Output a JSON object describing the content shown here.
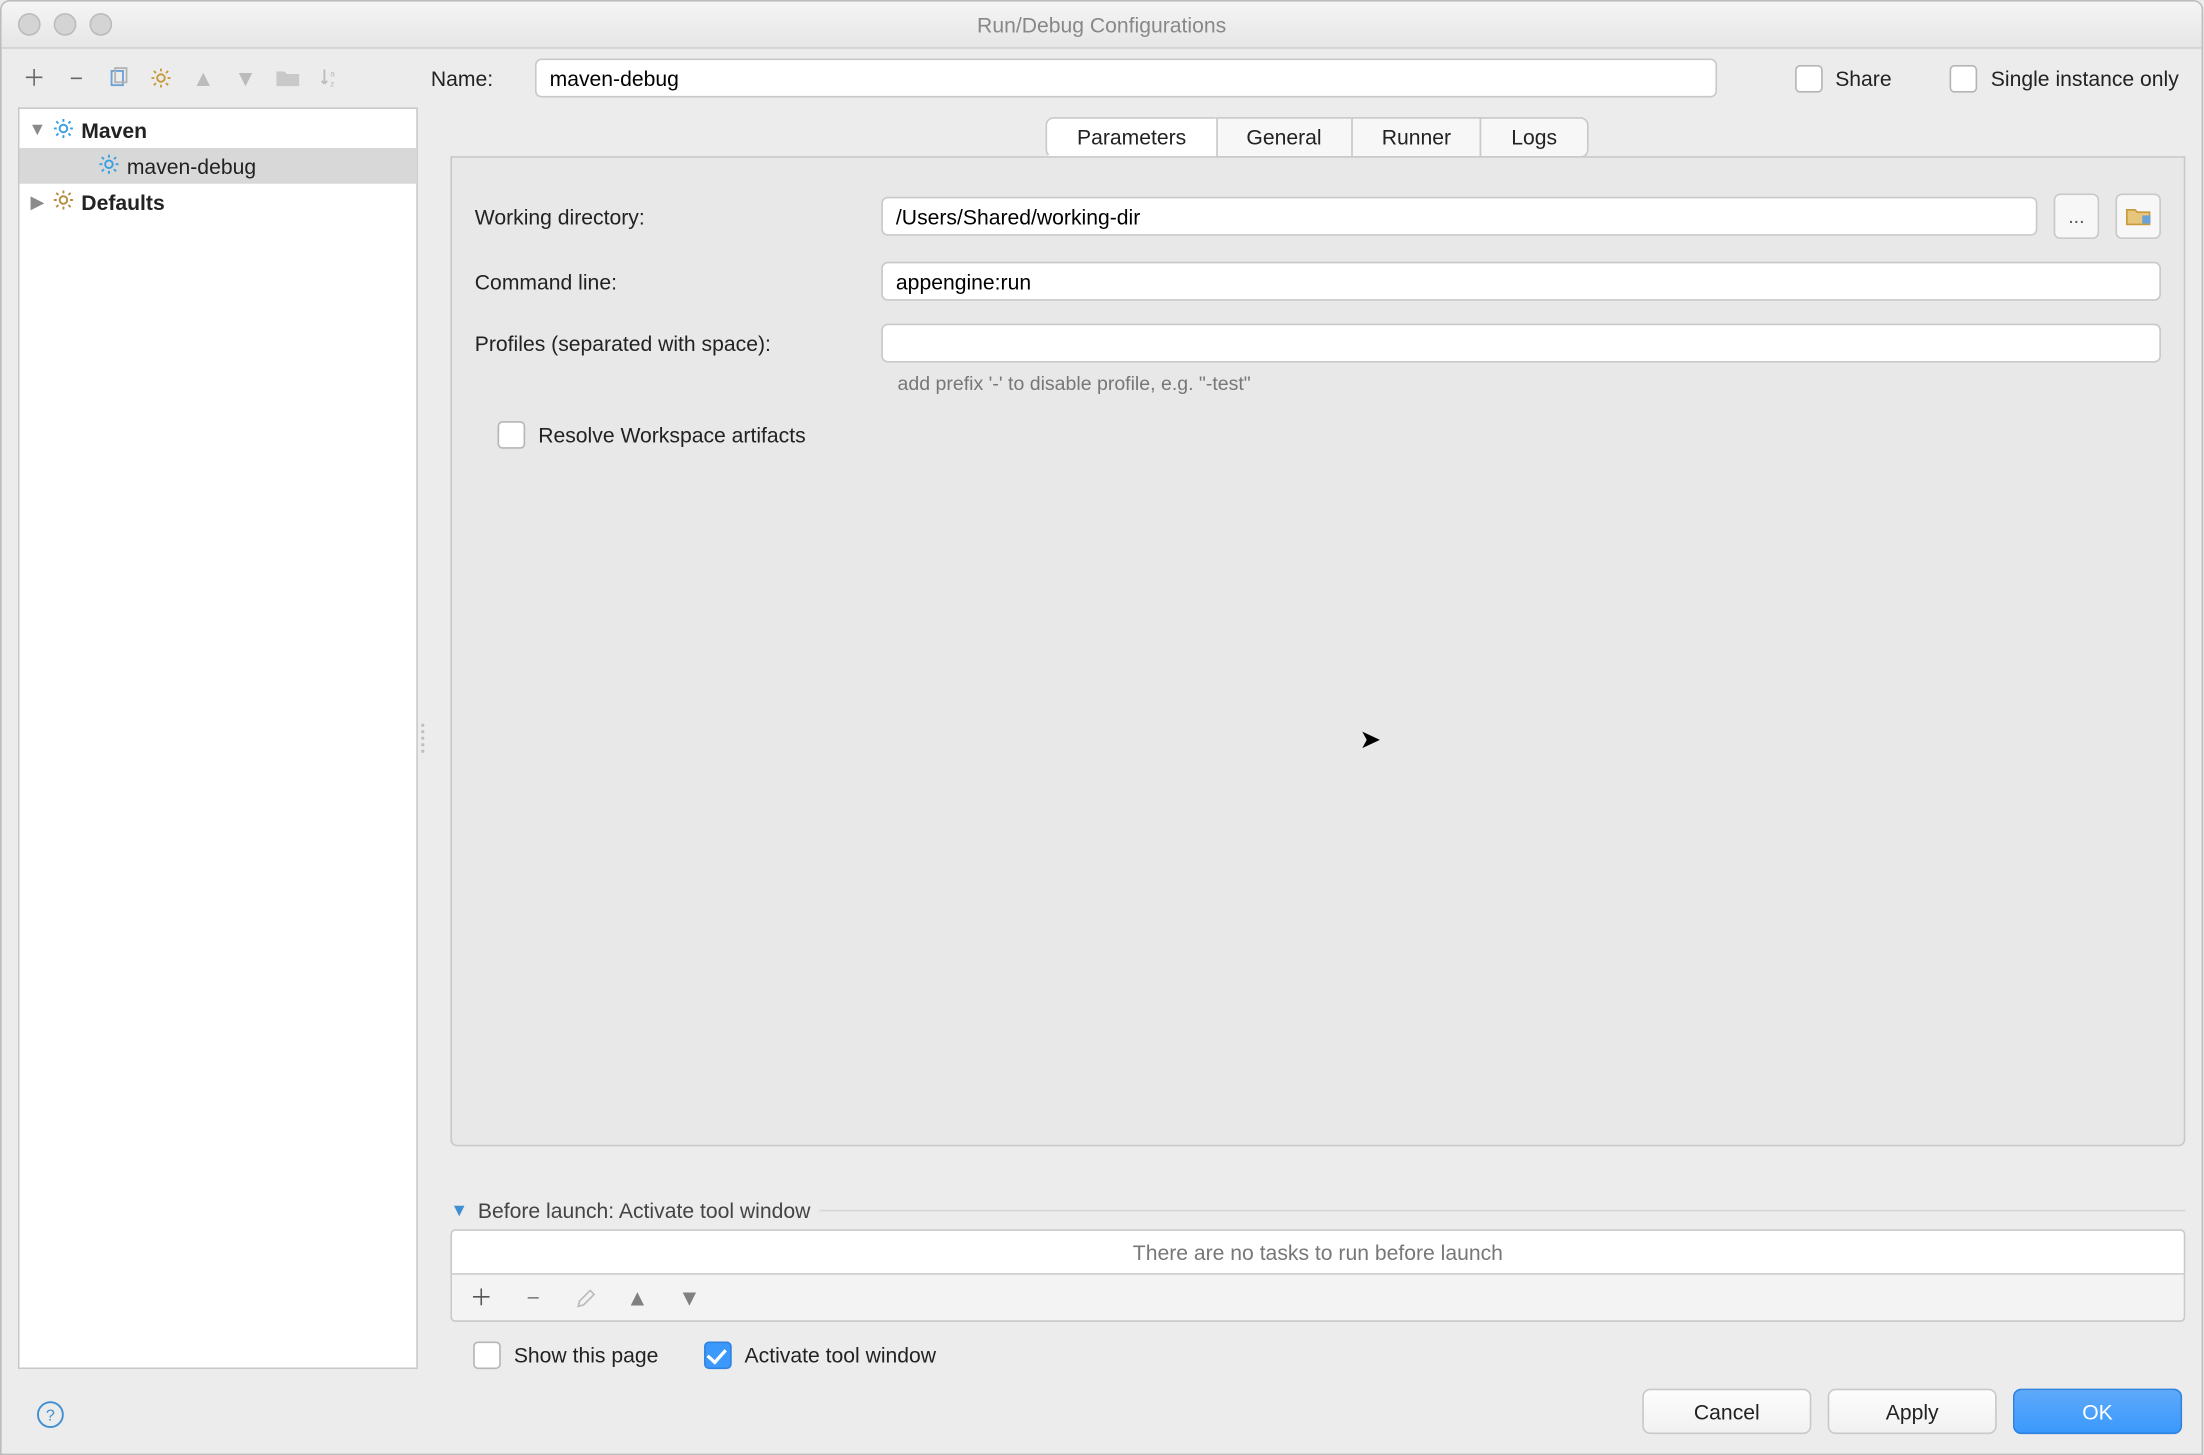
{
  "title": "Run/Debug Configurations",
  "toolbar": {
    "add_tip": "add",
    "remove_tip": "remove",
    "copy_tip": "copy",
    "templates_tip": "templates",
    "up_tip": "up",
    "down_tip": "down",
    "folder_tip": "folder",
    "sort_tip": "sort"
  },
  "name": {
    "label": "Name:",
    "value": "maven-debug"
  },
  "share": {
    "label": "Share",
    "checked": false
  },
  "single_instance": {
    "label": "Single instance only",
    "checked": false
  },
  "tree": {
    "maven": {
      "label": "Maven",
      "expanded": true
    },
    "maven_child": {
      "label": "maven-debug",
      "selected": true
    },
    "defaults": {
      "label": "Defaults",
      "expanded": false
    }
  },
  "tabs": {
    "parameters": "Parameters",
    "general": "General",
    "runner": "Runner",
    "logs": "Logs",
    "active": "parameters"
  },
  "params": {
    "working_dir": {
      "label": "Working directory:",
      "value": "/Users/Shared/working-dir"
    },
    "command_line": {
      "label": "Command line:",
      "value": "appengine:run"
    },
    "profiles": {
      "label": "Profiles (separated with space):",
      "value": "",
      "hint": "add prefix '-' to disable profile, e.g. \"-test\""
    },
    "resolve_artifacts": {
      "label": "Resolve Workspace artifacts",
      "checked": false
    },
    "browse": "...",
    "folder_pick": "folder"
  },
  "before_launch": {
    "header": "Before launch: Activate tool window",
    "empty_text": "There are no tasks to run before launch",
    "show_this_page": {
      "label": "Show this page",
      "checked": false
    },
    "activate_tool_window": {
      "label": "Activate tool window",
      "checked": true
    }
  },
  "buttons": {
    "cancel": "Cancel",
    "apply": "Apply",
    "ok": "OK"
  }
}
